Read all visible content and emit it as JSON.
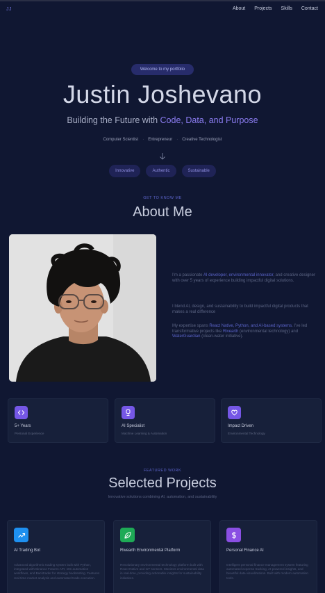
{
  "nav": {
    "logo": "JJ",
    "links": [
      "About",
      "Projects",
      "Skills",
      "Contact"
    ]
  },
  "hero": {
    "badge": "Welcome to my portfolio",
    "name": "Justin Joshevano",
    "subtitle_prefix": "Building the Future with ",
    "subtitle_accent": "Code, Data, and Purpose",
    "roles": [
      "Computer Scientist",
      "Entrepreneur",
      "Creative Technologist"
    ],
    "pills": [
      "Innovative",
      "Authentic",
      "Sustainable"
    ]
  },
  "about": {
    "kicker": "GET TO KNOW ME",
    "title": "About Me",
    "p1": {
      "a": "I'm a passionate ",
      "hl1": "AI developer",
      "b": ", ",
      "hl2": "environmental innovator",
      "c": ", and creative designer with over 5 years of experience building impactful digital solutions."
    },
    "p2": "I blend AI, design, and sustainability to build impactful digital products that makes a real difference",
    "p3": {
      "a": "My expertise spans ",
      "hl1": "React Native, Python, and AI-based systems",
      "b": ". I've led transformative projects like ",
      "hl2": "Rivearth",
      "c": " (environmental technology) and ",
      "hl3": "WaterGuardian",
      "d": " (clean-water initiative)."
    }
  },
  "stats": [
    {
      "icon": "code-icon",
      "title": "5+ Years",
      "sub": "Personal Experience"
    },
    {
      "icon": "trophy-icon",
      "title": "AI Specialist",
      "sub": "Machine Learning & Automation"
    },
    {
      "icon": "heart-icon",
      "title": "Impact Driven",
      "sub": "Environmental Technology"
    }
  ],
  "projects_section": {
    "kicker": "FEATURED WORK",
    "title": "Selected Projects",
    "subtitle": "Innovative solutions combining AI, automation, and sustainability"
  },
  "projects": [
    {
      "icon": "trending-up-icon",
      "color": "#1e90f0",
      "title": "AI Trading Bot",
      "desc": "Advanced algorithmic trading system built with Python, integrated with Binance Futures API, n8n automation workflows, and Backtrader for strategy backtesting. Features real-time market analysis and automated trade execution."
    },
    {
      "icon": "leaf-icon",
      "color": "#1eaa56",
      "title": "Rivearth Environmental Platform",
      "desc": "Revolutionary environmental technology platform built with React Native and IoT sensors. Monitors environmental data in real-time, providing actionable insights for sustainability initiatives."
    },
    {
      "icon": "dollar-icon",
      "color": "#8a4fe3",
      "title": "Personal Finance AI",
      "desc": "Intelligent personal finance management system featuring automated expense tracking, AI-powered insights, and beautiful data visualizations. Built with modern automation tools."
    }
  ],
  "colors": {
    "background": "#101732",
    "accent": "#8b7cf0",
    "card": "#17203a"
  }
}
